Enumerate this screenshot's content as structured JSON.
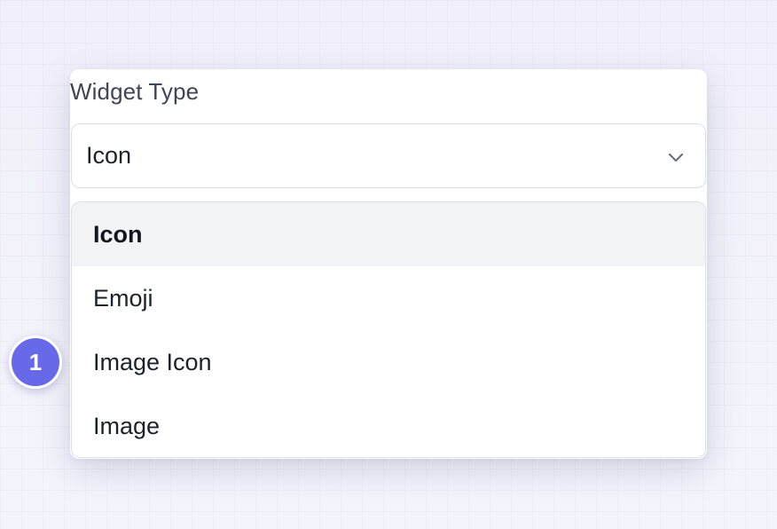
{
  "field": {
    "label": "Widget Type",
    "selected_value": "Icon",
    "dropdown_icon": "chevron-down-icon"
  },
  "dropdown": {
    "options": [
      {
        "label": "Icon",
        "selected": true
      },
      {
        "label": "Emoji",
        "selected": false
      },
      {
        "label": "Image Icon",
        "selected": false
      },
      {
        "label": "Image",
        "selected": false
      }
    ]
  },
  "annotation": {
    "step_number": "1"
  },
  "colors": {
    "badge": "#6769e8",
    "selected_option_bg": "#f2f3f5",
    "border": "#dcdfe6",
    "label_text": "#3e4553"
  }
}
